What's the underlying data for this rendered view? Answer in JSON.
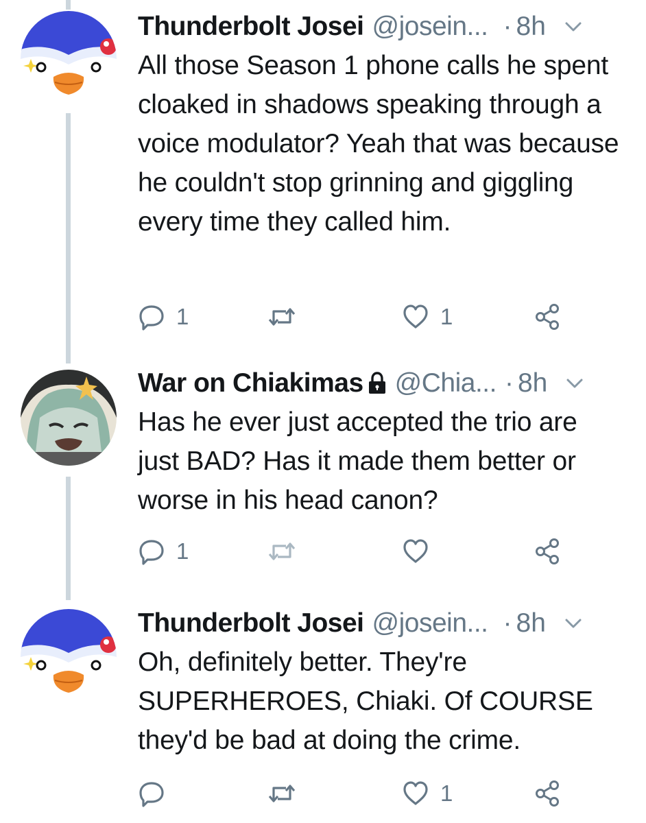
{
  "tweets": [
    {
      "display_name": "Thunderbolt Josei",
      "handle": "@josein...",
      "separator": "·",
      "time": "8h",
      "text": "All those Season 1 phone calls he spent cloaked in shadows speaking through a voice modulator? Yeah that was because he couldn't stop grinning and giggling every time they called him.",
      "reply_count": "1",
      "retweet_count": "",
      "like_count": "1",
      "locked": false,
      "avatar": "penguin-avatar"
    },
    {
      "display_name": "War on Chiakimas",
      "handle": "@Chia...",
      "separator": "·",
      "time": "8h",
      "text": "Has he ever just accepted the trio are just BAD? Has it made them better or worse in his head canon?",
      "reply_count": "1",
      "retweet_count": "",
      "like_count": "",
      "locked": true,
      "avatar": "anime-avatar"
    },
    {
      "display_name": "Thunderbolt Josei",
      "handle": "@josein...",
      "separator": "·",
      "time": "8h",
      "text": "Oh, definitely better. They're SUPERHEROES, Chiaki. Of COURSE they'd be bad at doing the crime.",
      "reply_count": "",
      "retweet_count": "",
      "like_count": "1",
      "locked": false,
      "avatar": "penguin-avatar"
    }
  ],
  "colors": {
    "text": "#14171a",
    "secondary": "#657786",
    "icon": "#657786",
    "thread_line": "#ccd6dd"
  },
  "icons": [
    "reply-icon",
    "retweet-icon",
    "like-icon",
    "share-icon",
    "chevron-down-icon",
    "lock-icon"
  ]
}
